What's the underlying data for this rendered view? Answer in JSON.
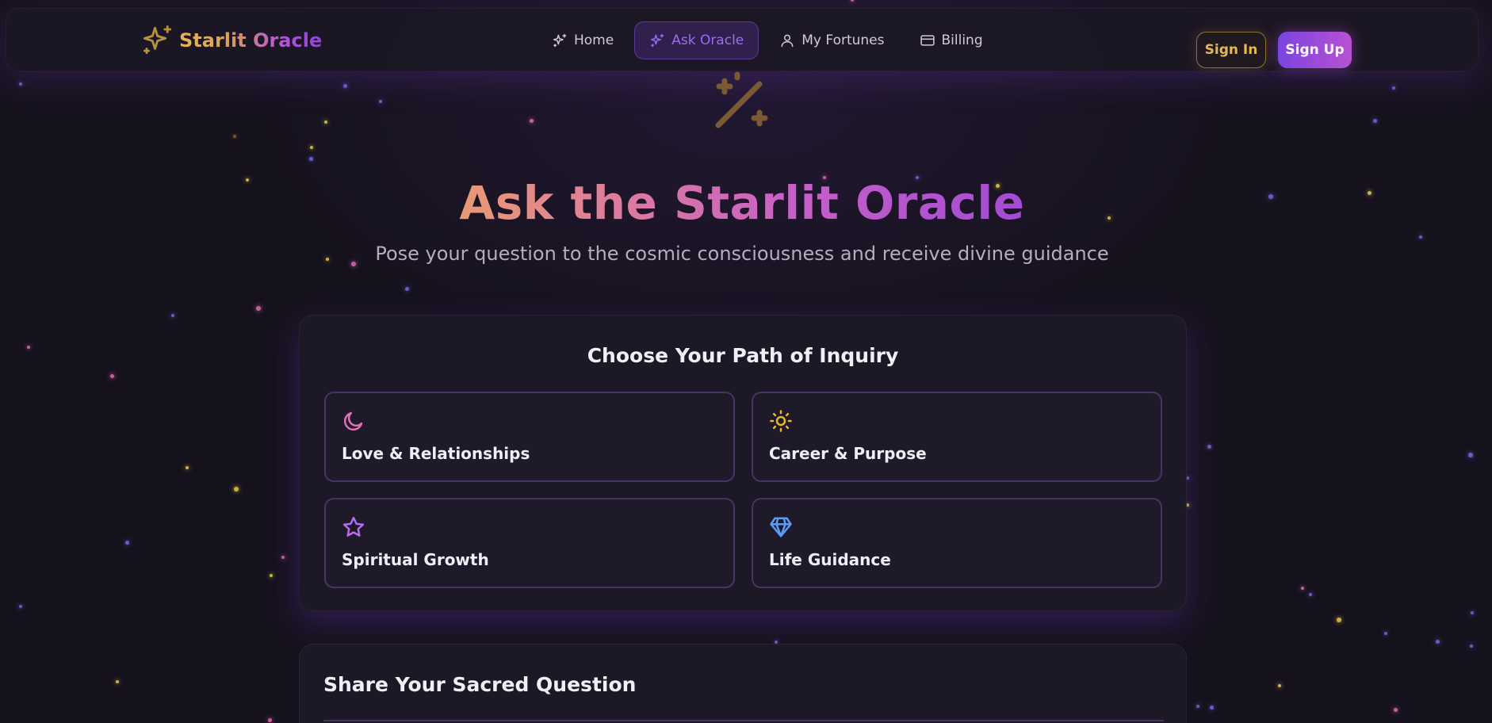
{
  "colors": {
    "background": "#16121d",
    "gold": "#e9b84a",
    "purple": "#9a6cf0",
    "pink": "#e36fb4"
  },
  "nav": {
    "brand": {
      "name": "Starlit Oracle",
      "icon": "sparkles-icon"
    },
    "links": [
      {
        "label": "Home",
        "icon": "sparkles-icon",
        "active": false
      },
      {
        "label": "Ask Oracle",
        "icon": "sparkles-icon",
        "active": true
      },
      {
        "label": "My Fortunes",
        "icon": "user-icon",
        "active": false
      },
      {
        "label": "Billing",
        "icon": "credit-card-icon",
        "active": false
      }
    ],
    "sign_in": "Sign In",
    "sign_up": "Sign Up"
  },
  "hero": {
    "icon": "magic-wand-icon",
    "title": "Ask the Starlit Oracle",
    "subtitle": "Pose your question to the cosmic consciousness and receive divine guidance"
  },
  "paths": {
    "title": "Choose Your Path of Inquiry",
    "options": [
      {
        "label": "Love & Relationships",
        "icon": "moon-icon",
        "color": "#e36fb4"
      },
      {
        "label": "Career & Purpose",
        "icon": "sun-icon",
        "color": "#e9b82a"
      },
      {
        "label": "Spiritual Growth",
        "icon": "star-icon",
        "color": "#b46cf0"
      },
      {
        "label": "Life Guidance",
        "icon": "gem-icon",
        "color": "#5b9cf5"
      }
    ]
  },
  "question": {
    "title": "Share Your Sacred Question"
  }
}
